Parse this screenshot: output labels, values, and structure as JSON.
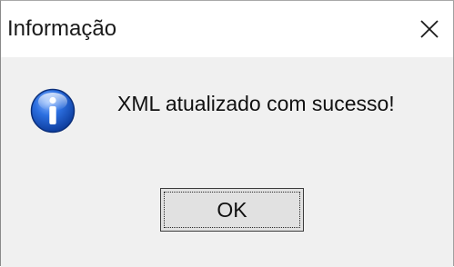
{
  "dialog": {
    "title": "Informação",
    "message": "XML atualizado com sucesso!",
    "ok_label": "OK",
    "icon": "info-icon",
    "close_icon": "close-icon"
  },
  "colors": {
    "titlebar_bg": "#ffffff",
    "body_bg": "#f0f0f0",
    "button_bg": "#e1e1e1",
    "icon_blue": "#1f5fd6"
  }
}
